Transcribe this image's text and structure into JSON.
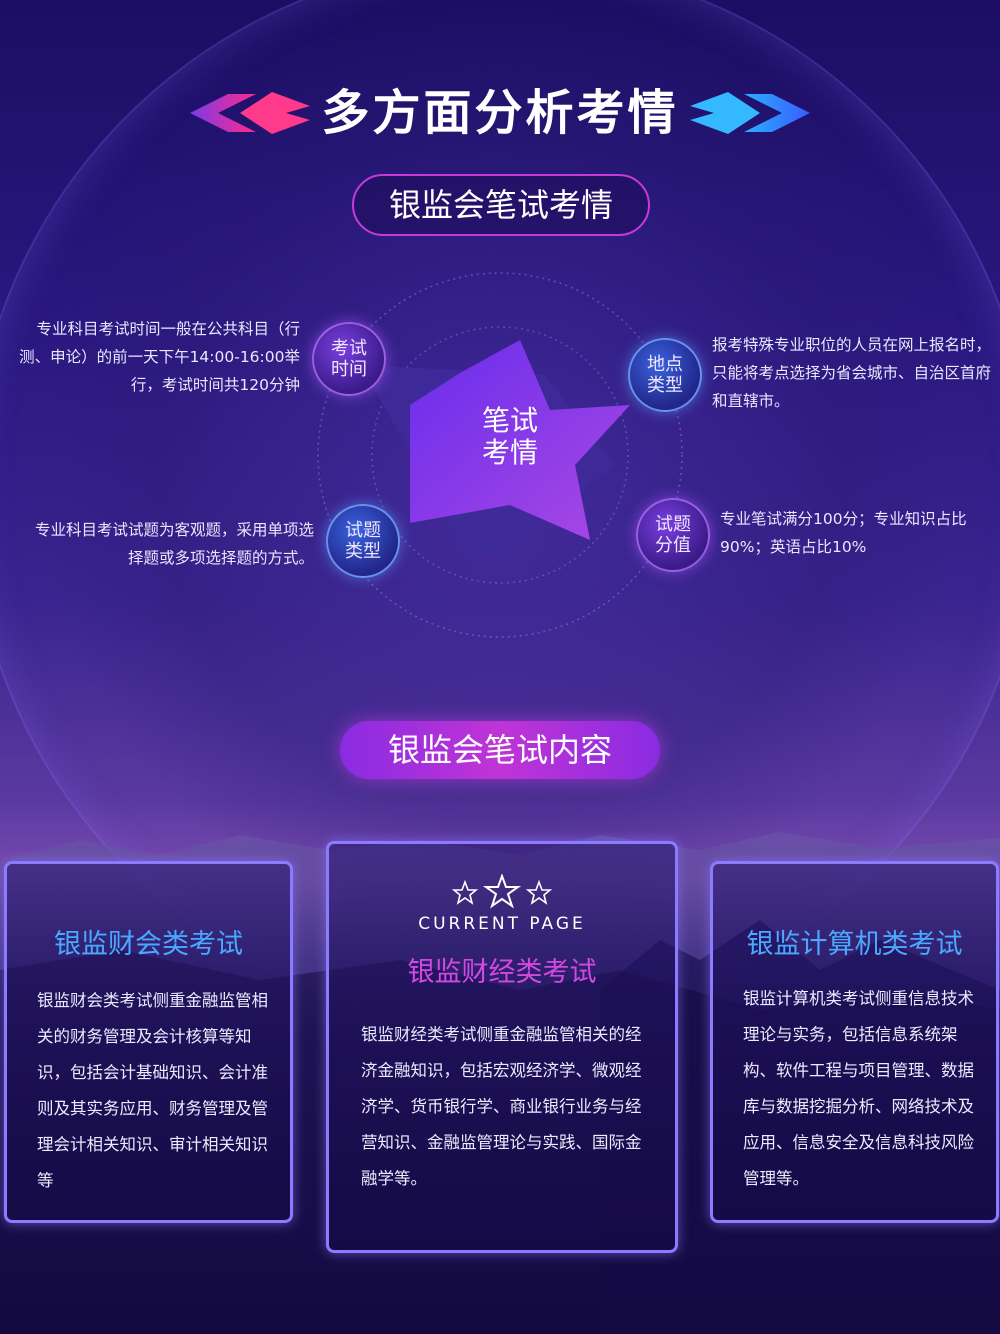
{
  "header": {
    "title": "多方面分析考情",
    "subtitle_pill": "银监会笔试考情"
  },
  "hub": {
    "center": "笔试\n考情",
    "nodes": {
      "exam_time": {
        "label": "考试\n时间",
        "desc": "专业科目考试时间一般在公共科目（行测、申论）的前一天下午14:00-16:00举行，考试时间共120分钟"
      },
      "location_type": {
        "label": "地点\n类型",
        "desc": "报考特殊专业职位的人员在网上报名时，只能将考点选择为省会城市、自治区首府和直辖市。"
      },
      "question_type": {
        "label": "试题\n类型",
        "desc": "专业科目考试试题为客观题，采用单项选择题或多项选择题的方式。"
      },
      "score": {
        "label": "试题\n分值",
        "desc": "专业笔试满分100分；专业知识占比90%；英语占比10%"
      }
    }
  },
  "content": {
    "pill": "银监会笔试内容",
    "current_page": "CURRENT PAGE",
    "cards": [
      {
        "title": "银监财会类考试",
        "body": "银监财会类考试侧重金融监管相关的财务管理及会计核算等知识，包括会计基础知识、会计准则及其实务应用、财务管理及管理会计相关知识、审计相关知识等"
      },
      {
        "title": "银监财经类考试",
        "body": "银监财经类考试侧重金融监管相关的经济金融知识，包括宏观经济学、微观经济学、货币银行学、商业银行业务与经营知识、金融监管理论与实践、国际金融学等。"
      },
      {
        "title": "银监计算机类考试",
        "body": "银监计算机类考试侧重信息技术理论与实务，包括信息系统架构、软件工程与项目管理、数据库与数据挖掘分析、网络技术及应用、信息安全及信息科技风险管理等。"
      }
    ]
  },
  "colors": {
    "accent_magenta": "#c43bd8",
    "accent_blue": "#4aa8ff",
    "card_border": "#8a7bff"
  }
}
